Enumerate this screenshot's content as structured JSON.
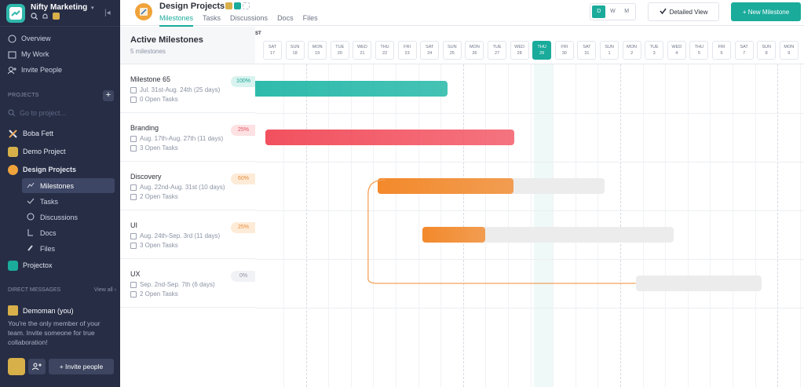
{
  "workspace": {
    "name": "Nifty Marketing"
  },
  "sidebar": {
    "nav": [
      {
        "label": "Overview",
        "icon": "overview-icon"
      },
      {
        "label": "My Work",
        "icon": "calendar-icon"
      },
      {
        "label": "Invite People",
        "icon": "invite-icon"
      }
    ],
    "projects_label": "PROJECTS",
    "goto_placeholder": "Go to project...",
    "projects": [
      {
        "label": "Boba Fett",
        "color": "#e2e5ec"
      },
      {
        "label": "Demo Project",
        "color": "#d8b04a"
      },
      {
        "label": "Design Projects",
        "color": "#f0a33b"
      }
    ],
    "subnav": [
      {
        "label": "Milestones",
        "icon": "milestones-icon"
      },
      {
        "label": "Tasks",
        "icon": "check-icon"
      },
      {
        "label": "Discussions",
        "icon": "discussion-icon"
      },
      {
        "label": "Docs",
        "icon": "docs-icon"
      },
      {
        "label": "Files",
        "icon": "files-icon"
      }
    ],
    "projectox": {
      "label": "Projectox",
      "color": "#1aab9b"
    },
    "dm_label": "DIRECT MESSAGES",
    "view_all": "View all",
    "dm_user": "Demoman (you)",
    "dm_note": "You're the only member of your team. Invite someone for true collaboration!",
    "invite_button": "+ Invite people"
  },
  "topbar": {
    "project_title": "Design Projects",
    "tabs": [
      "Milestones",
      "Tasks",
      "Discussions",
      "Docs",
      "Files"
    ],
    "zoom": [
      "D",
      "W",
      "M"
    ],
    "detailed_view": "Detailed View",
    "new_milestone": "+ New Milestone"
  },
  "milestones": {
    "title": "Active Milestones",
    "count": "5 milestones",
    "items": [
      {
        "name": "Milestone 65",
        "dates": "Jul. 31st-Aug. 24th (25 days)",
        "tasks": "0 Open Tasks",
        "percent": "100%",
        "progress": 1.0,
        "color": "#16b3a2",
        "pct_bg": "#d8f3ef",
        "pct_fg": "#16a594"
      },
      {
        "name": "Branding",
        "dates": "Aug. 17th-Aug. 27th (11 days)",
        "tasks": "3 Open Tasks",
        "percent": "25%",
        "progress": 1.0,
        "color": "#f2515f",
        "pct_bg": "#fde1e3",
        "pct_fg": "#e0505c"
      },
      {
        "name": "Discovery",
        "dates": "Aug. 22nd-Aug. 31st (10 days)",
        "tasks": "2 Open Tasks",
        "percent": "60%",
        "progress": 0.6,
        "color": "#f3892b",
        "pct_bg": "#fdebd8",
        "pct_fg": "#e98c3a"
      },
      {
        "name": "UI",
        "dates": "Aug. 24th-Sep. 3rd (11 days)",
        "tasks": "3 Open Tasks",
        "percent": "25%",
        "progress": 0.25,
        "color": "#f3892b",
        "pct_bg": "#fdebd8",
        "pct_fg": "#e98c3a"
      },
      {
        "name": "UX",
        "dates": "Sep. 2nd-Sep. 7th (6 days)",
        "tasks": "2 Open Tasks",
        "percent": "0%",
        "progress": 0.0,
        "color": "#f3892b",
        "pct_bg": "#f1f2f5",
        "pct_fg": "#8a92a3"
      }
    ]
  },
  "timeline": {
    "month_partial": "ST",
    "days": [
      [
        "SAT",
        "17"
      ],
      [
        "SUN",
        "18"
      ],
      [
        "MON",
        "19"
      ],
      [
        "TUE",
        "20"
      ],
      [
        "WED",
        "21"
      ],
      [
        "THU",
        "22"
      ],
      [
        "FRI",
        "23"
      ],
      [
        "SAT",
        "24"
      ],
      [
        "SUN",
        "25"
      ],
      [
        "MON",
        "26"
      ],
      [
        "TUE",
        "27"
      ],
      [
        "WED",
        "28"
      ],
      [
        "THU",
        "29"
      ],
      [
        "FRI",
        "30"
      ],
      [
        "SAT",
        "31"
      ],
      [
        "SUN",
        "1"
      ],
      [
        "MON",
        "2"
      ],
      [
        "TUE",
        "3"
      ],
      [
        "WED",
        "4"
      ],
      [
        "THU",
        "5"
      ],
      [
        "FRI",
        "6"
      ],
      [
        "SAT",
        "7"
      ],
      [
        "SUN",
        "8"
      ],
      [
        "MON",
        "9"
      ]
    ],
    "today_index": 12
  }
}
